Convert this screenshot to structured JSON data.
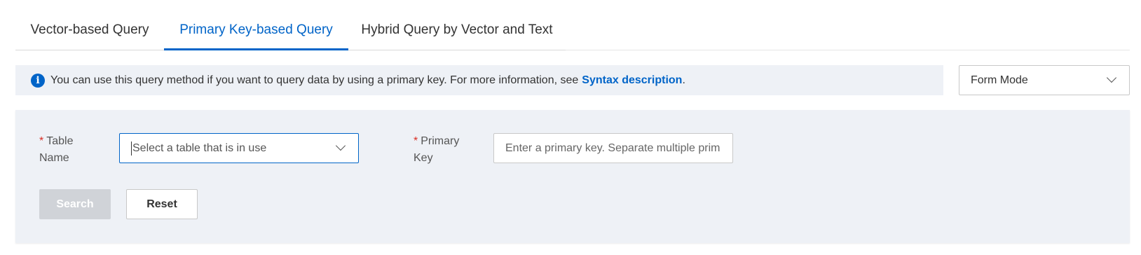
{
  "tabs": [
    {
      "label": "Vector-based Query",
      "active": false
    },
    {
      "label": "Primary Key-based Query",
      "active": true
    },
    {
      "label": "Hybrid Query by Vector and Text",
      "active": false
    }
  ],
  "banner": {
    "text": "You can use this query method if you want to query data by using a primary key. For more information, see",
    "link_text": "Syntax description",
    "link_suffix": ".",
    "icon": "info-icon"
  },
  "mode_select": {
    "value": "Form Mode",
    "icon": "chevron-down-icon"
  },
  "form": {
    "required_mark": "*",
    "table_label_line1": "Table",
    "table_label_line2": "Name",
    "table_select_placeholder": "Select a table that is in use",
    "pk_label_line1": "Primary",
    "pk_label_line2": "Key",
    "pk_input_placeholder": "Enter a primary key. Separate multiple prim"
  },
  "buttons": {
    "search": "Search",
    "reset": "Reset"
  },
  "colors": {
    "accent": "#0064c8",
    "panel_bg": "#eef1f6",
    "required": "#d93026",
    "disabled_button": "#d0d3d8"
  }
}
